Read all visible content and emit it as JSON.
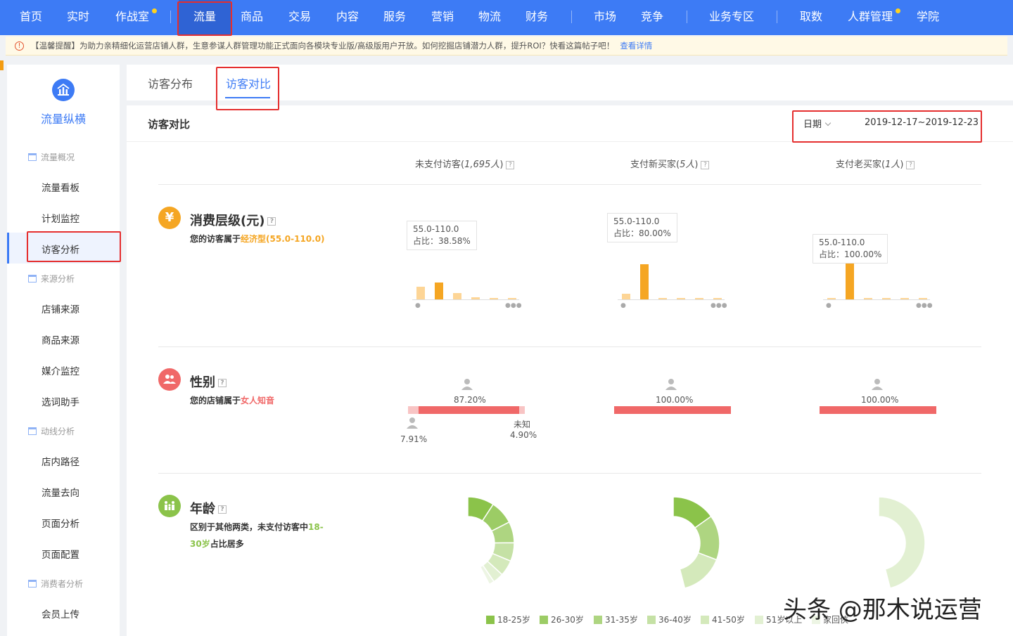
{
  "topnav": {
    "items": [
      {
        "label": "首页"
      },
      {
        "label": "实时"
      },
      {
        "label": "作战室"
      },
      {
        "label": "流量"
      },
      {
        "label": "商品"
      },
      {
        "label": "交易"
      },
      {
        "label": "内容"
      },
      {
        "label": "服务"
      },
      {
        "label": "营销"
      },
      {
        "label": "物流"
      },
      {
        "label": "财务"
      },
      {
        "label": "市场"
      },
      {
        "label": "竞争"
      },
      {
        "label": "业务专区"
      },
      {
        "label": "取数"
      },
      {
        "label": "人群管理"
      },
      {
        "label": "学院"
      }
    ],
    "active": "流量",
    "accent": "#3d7bf5"
  },
  "notice": {
    "text": "【温馨提醒】为助力亲精细化运营店铺人群，生意参谋人群管理功能正式面向各模块专业版/高级版用户开放。如何挖掘店铺潜力人群，提升ROI？快看这篇帖子吧！",
    "link": "查看详情"
  },
  "sidebar": {
    "title": "流量纵横",
    "groups": [
      {
        "label": "流量概况",
        "items": [
          {
            "label": "流量看板"
          },
          {
            "label": "计划监控"
          },
          {
            "label": "访客分析"
          }
        ]
      },
      {
        "label": "来源分析",
        "items": [
          {
            "label": "店铺来源"
          },
          {
            "label": "商品来源"
          },
          {
            "label": "媒介监控"
          },
          {
            "label": "选词助手"
          }
        ]
      },
      {
        "label": "动线分析",
        "items": [
          {
            "label": "店内路径"
          },
          {
            "label": "流量去向"
          },
          {
            "label": "页面分析"
          },
          {
            "label": "页面配置"
          }
        ]
      },
      {
        "label": "消费者分析",
        "items": [
          {
            "label": "会员上传"
          }
        ]
      }
    ],
    "active": "访客分析"
  },
  "tabs": [
    {
      "label": "访客分布"
    },
    {
      "label": "访客对比"
    }
  ],
  "panel": {
    "title": "访客对比",
    "date_label": "日期",
    "date_value": "2019-12-17~2019-12-23"
  },
  "columns": [
    {
      "name": "未支付访客",
      "count": "1,695人"
    },
    {
      "name": "支付新买家",
      "count": "5人"
    },
    {
      "name": "支付老买家",
      "count": "1人"
    }
  ],
  "consumption": {
    "title": "消费层级(元)",
    "desc_prefix": "您的访客属于",
    "desc_highlight": "经济型(55.0-110.0)",
    "icon": "yen-icon",
    "color": "#f5a623",
    "tooltip_range": "55.0-110.0",
    "tooltips": [
      "占比：38.58%",
      "占比：80.00%",
      "占比：100.00%"
    ],
    "bars": [
      [
        0.29,
        0.3858,
        0.15,
        0.05,
        0.015,
        0.01
      ],
      [
        0.13,
        0.8,
        0.01,
        0.01,
        0.01,
        0.01
      ],
      [
        0.01,
        1.0,
        0.01,
        0.01,
        0.01,
        0.01
      ]
    ],
    "highlight_index": 1
  },
  "gender": {
    "title": "性别",
    "desc_prefix": "您的店铺属于",
    "desc_highlight": "女人知音",
    "icon": "users-icon",
    "color": "#f06868",
    "cols": [
      {
        "female": "87.20%",
        "male": "7.91%",
        "unknown_label": "未知",
        "unknown": "4.90%"
      },
      {
        "female": "100.00%"
      },
      {
        "female": "100.00%"
      }
    ]
  },
  "age": {
    "title": "年龄",
    "desc_prefix": "区别于其他两类，未支付访客中",
    "desc_highlight": "18-30岁",
    "desc_suffix": "占比居多",
    "icon": "family-icon",
    "color": "#8bc34a",
    "legend": [
      "18-25岁",
      "26-30岁",
      "31-35岁",
      "36-40岁",
      "41-50岁",
      "51岁以上",
      "家回俠"
    ]
  },
  "watermark": "头条 @那木说运营"
}
